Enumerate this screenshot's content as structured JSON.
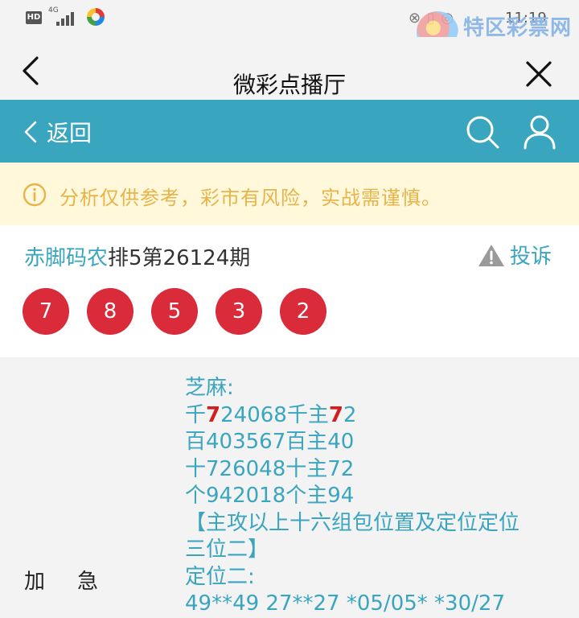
{
  "status_bar": {
    "hd": "HD",
    "network": "4G",
    "right_icons": "⊗ ▯ ◎",
    "time": "11:19",
    "colors": {
      "icon": "#555555"
    }
  },
  "watermark": {
    "site_name": "特区彩票网",
    "url": "www.tqcp.net"
  },
  "titlebar": {
    "title": "微彩点播厅"
  },
  "nav": {
    "back_label": "返回",
    "background": "#3aa5bf"
  },
  "notice": {
    "text": "分析仅供参考，彩市有风险，实战需谨慎。",
    "color": "#e8b34a"
  },
  "issue": {
    "author": "赤脚码农",
    "period": "排5第26124期",
    "report_label": "投诉",
    "balls": [
      "7",
      "8",
      "5",
      "3",
      "2"
    ],
    "ball_color": "#d92b3a"
  },
  "content": {
    "side_label": "加急",
    "lines": [
      {
        "parts": [
          {
            "t": "芝麻:"
          }
        ]
      },
      {
        "parts": [
          {
            "t": "千"
          },
          {
            "t": "7",
            "hl": true
          },
          {
            "t": "24068千主"
          },
          {
            "t": "7",
            "hl": true
          },
          {
            "t": "2"
          }
        ]
      },
      {
        "parts": [
          {
            "t": "百403567百主40"
          }
        ]
      },
      {
        "parts": [
          {
            "t": "十726048十主72"
          }
        ]
      },
      {
        "parts": [
          {
            "t": "个942018个主94"
          }
        ]
      },
      {
        "parts": [
          {
            "t": "【主攻以上十六组包位置及定位定位"
          }
        ]
      },
      {
        "parts": [
          {
            "t": "三位二】"
          }
        ]
      },
      {
        "parts": [
          {
            "t": "定位二:"
          }
        ]
      },
      {
        "parts": [
          {
            "t": "49**49  27**27  *05/05*  *30/27"
          }
        ]
      }
    ]
  }
}
